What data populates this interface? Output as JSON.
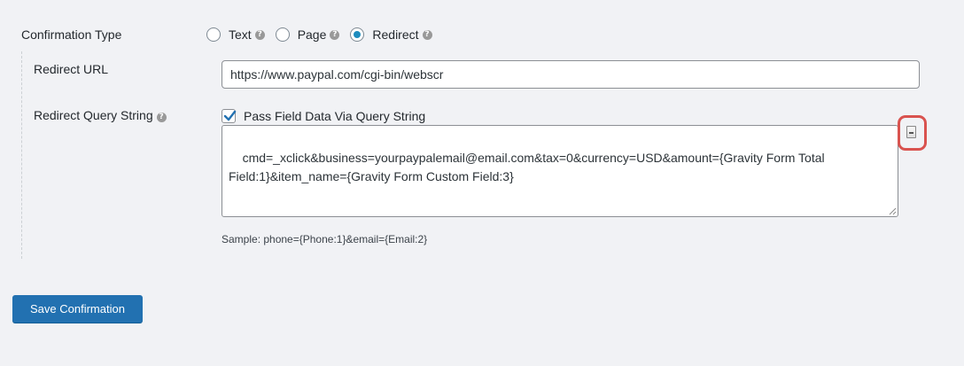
{
  "confirmation_type": {
    "label": "Confirmation Type",
    "options": [
      {
        "label": "Text",
        "checked": false
      },
      {
        "label": "Page",
        "checked": false
      },
      {
        "label": "Redirect",
        "checked": true
      }
    ]
  },
  "redirect_url": {
    "label": "Redirect URL",
    "value": "https://www.paypal.com/cgi-bin/webscr"
  },
  "redirect_query": {
    "label": "Redirect Query String",
    "checkbox_label": "Pass Field Data Via Query String",
    "checkbox_checked": true,
    "value": "cmd=_xclick&business=yourpaypalemail@email.com&tax=0&currency=USD&amount={Gravity Form Total Field:1}&item_name={Gravity Form Custom Field:3}",
    "sample": "Sample: phone={Phone:1}&email={Email:2}"
  },
  "save_button": "Save Confirmation",
  "colors": {
    "accent": "#2271b1",
    "highlight_box": "#d9534f"
  },
  "icons": {
    "help": "question-circle-icon",
    "merge_tag": "merge-tag-icon"
  }
}
